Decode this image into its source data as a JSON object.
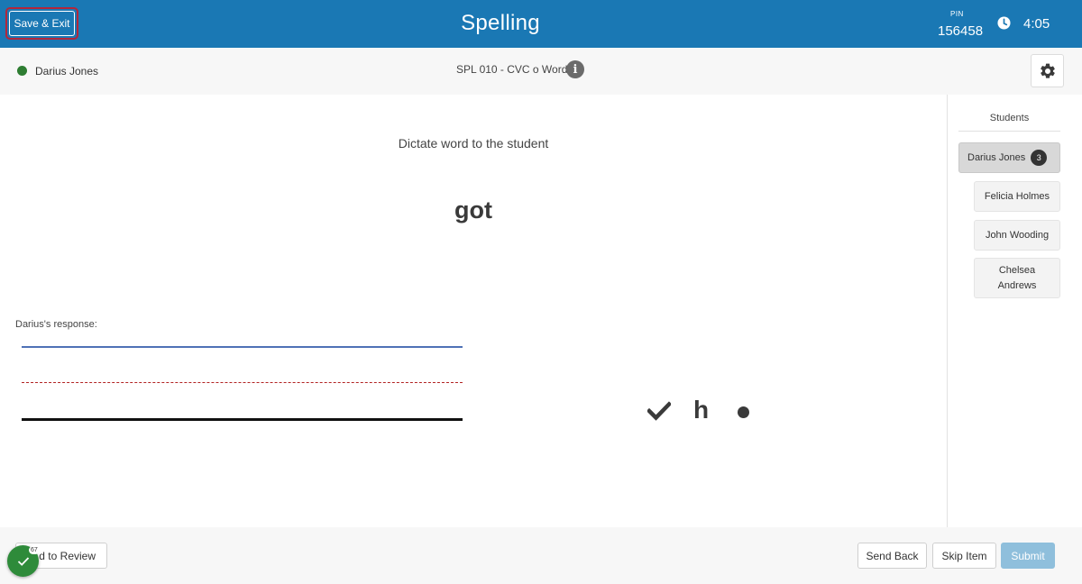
{
  "header": {
    "save_exit_label": "Save & Exit",
    "title": "Spelling",
    "pin_label": "PIN",
    "pin_value": "156458",
    "clock_icon": "clock-icon",
    "timer": "4:05"
  },
  "subheader": {
    "student_name": "Darius Jones",
    "student_status_color": "#2e7d32",
    "item_title": "SPL 010 - CVC o Words",
    "info_icon": "info-icon",
    "info_glyph": "i",
    "settings_icon": "gear-icon"
  },
  "main": {
    "instruction": "Dictate word to the student",
    "word": "got",
    "response_label": "Darius's response:",
    "response_marks": {
      "check_icon": "check-icon",
      "letter": "h",
      "dot_icon": "dot-icon"
    }
  },
  "sidebar": {
    "title": "Students",
    "students": [
      {
        "name": "Darius Jones",
        "badge": "3",
        "active": true
      },
      {
        "name": "Felicia Holmes"
      },
      {
        "name": "John Wooding"
      },
      {
        "name": "Chelsea Andrews"
      }
    ]
  },
  "footer": {
    "add_review_label": "d to Review",
    "progress_count": "67",
    "progress_icon": "check-icon",
    "send_back_label": "Send Back",
    "skip_item_label": "Skip Item",
    "submit_label": "Submit"
  },
  "colors": {
    "header_bg": "#1a78b4",
    "submit_disabled": "#8fbfdc",
    "progress_green": "#2e8b3a",
    "highlight_border": "#b3263a"
  }
}
